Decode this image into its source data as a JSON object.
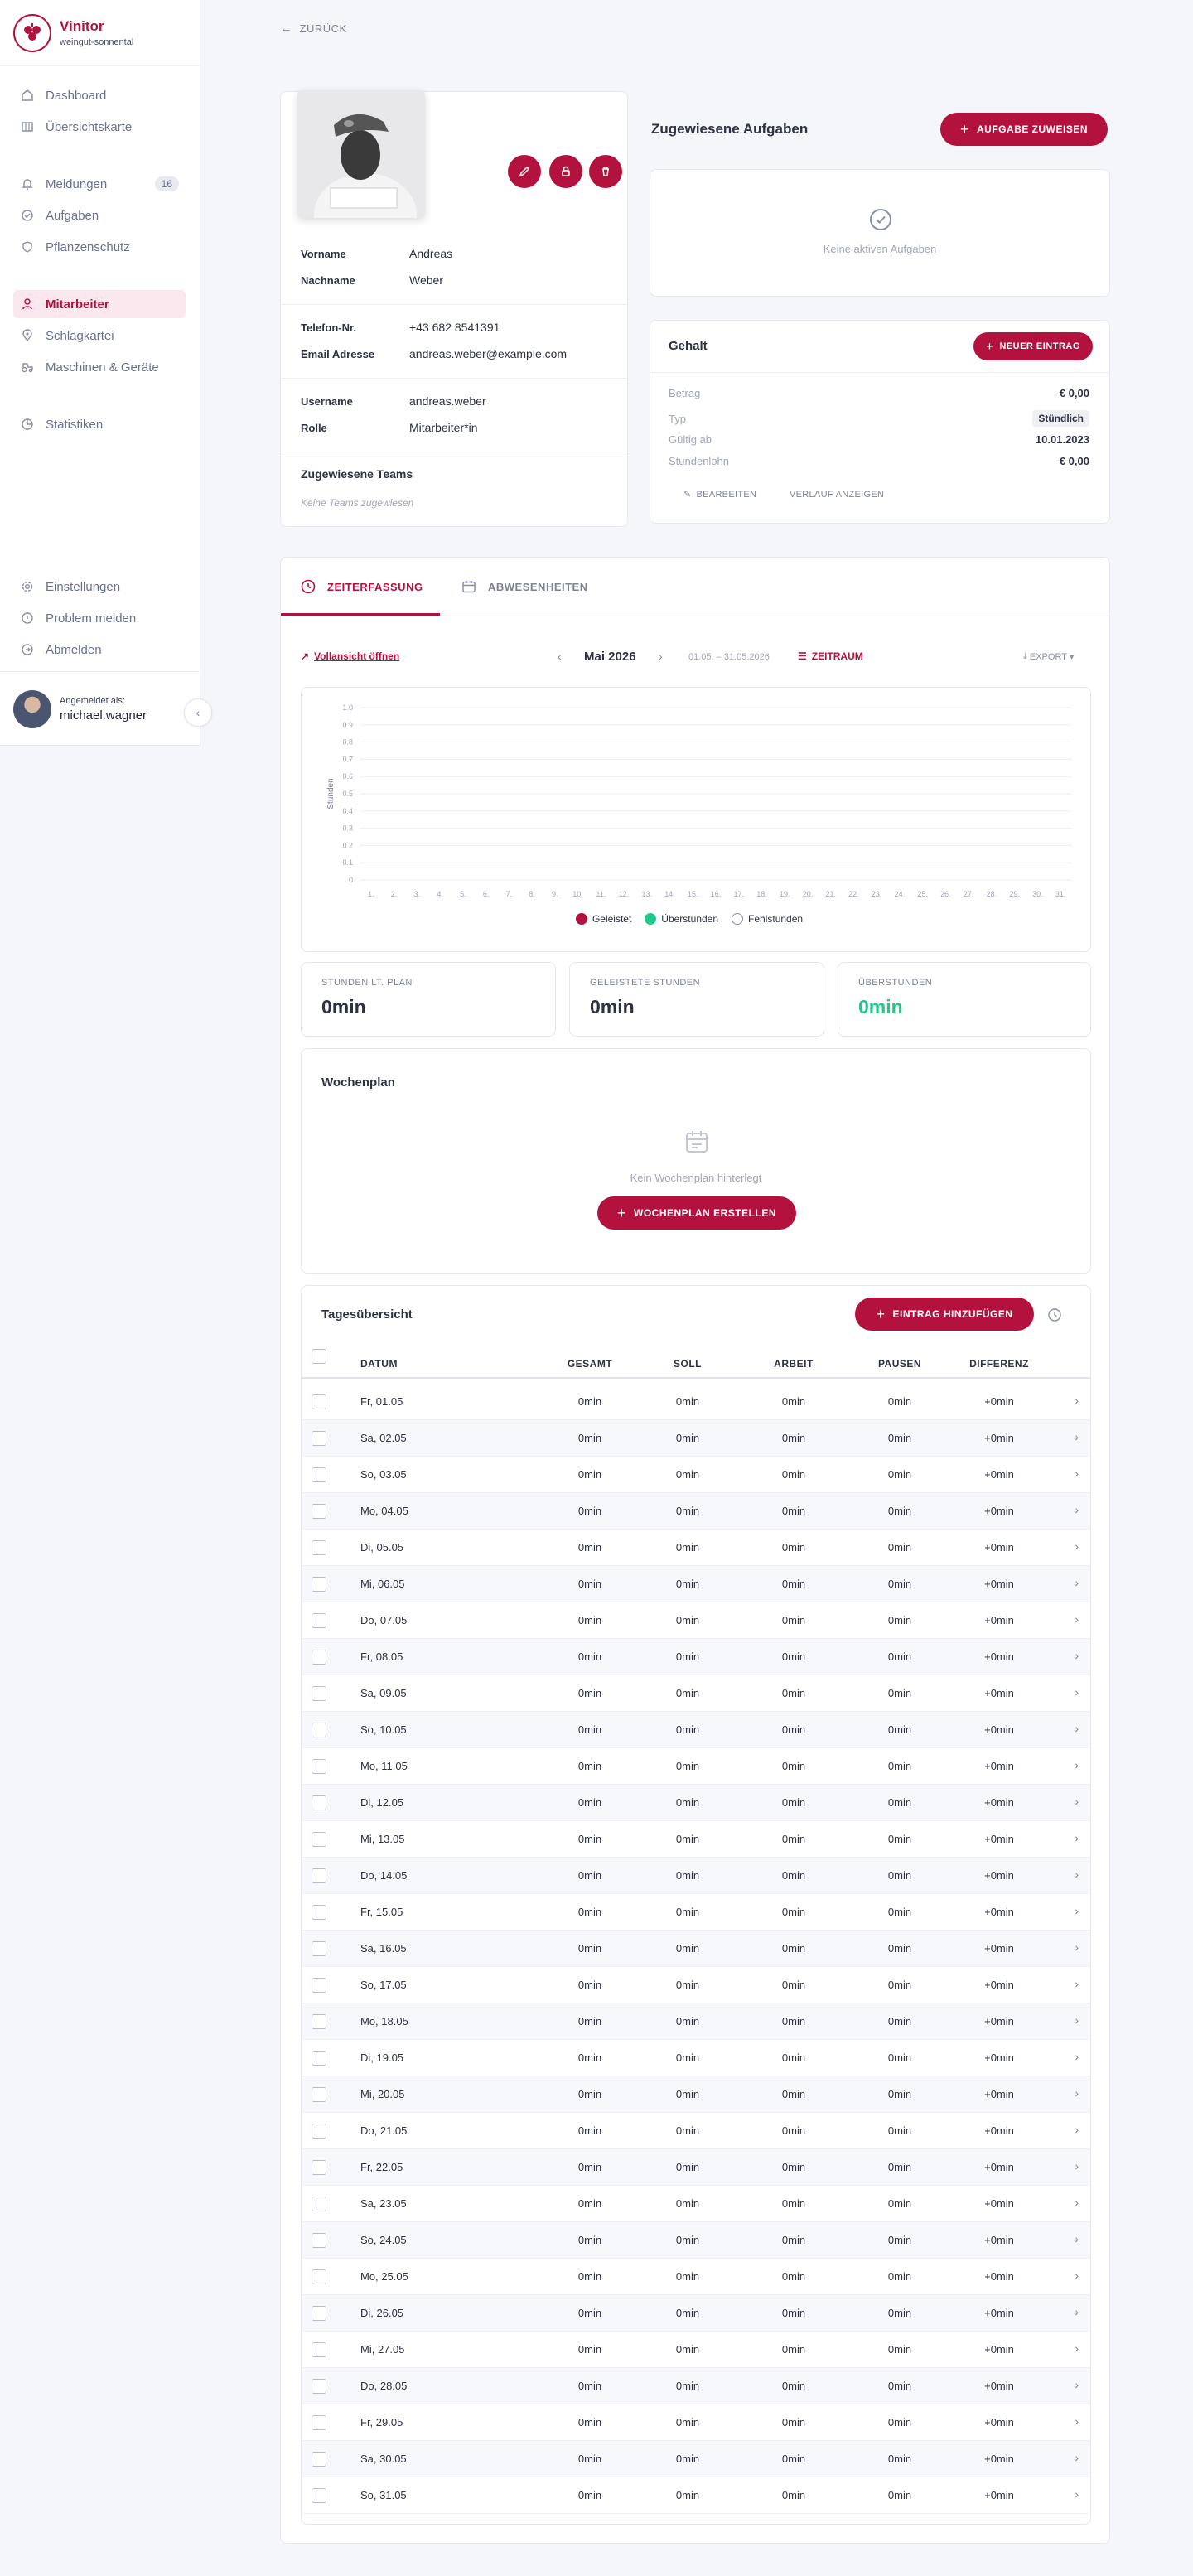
{
  "app": {
    "name": "Vinitor",
    "tenant": "weingut-sonnental"
  },
  "sidebar": {
    "group1": [
      {
        "label": "Dashboard",
        "icon": "home-icon"
      },
      {
        "label": "Übersichtskarte",
        "icon": "map-icon"
      }
    ],
    "group2": [
      {
        "label": "Meldungen",
        "icon": "bell-icon",
        "badge": "16"
      },
      {
        "label": "Aufgaben",
        "icon": "check-circle-icon"
      },
      {
        "label": "Pflanzenschutz",
        "icon": "shield-icon"
      }
    ],
    "group3": [
      {
        "label": "Mitarbeiter",
        "icon": "user-icon"
      },
      {
        "label": "Schlagkartei",
        "icon": "map-pin-icon"
      },
      {
        "label": "Maschinen & Geräte",
        "icon": "tractor-icon"
      }
    ],
    "group4": [
      {
        "label": "Statistiken",
        "icon": "pie-chart-icon"
      }
    ],
    "bottom": [
      {
        "label": "Einstellungen",
        "icon": "gear-icon"
      },
      {
        "label": "Problem melden",
        "icon": "alert-icon"
      },
      {
        "label": "Abmelden",
        "icon": "logout-icon"
      }
    ],
    "user": {
      "prefix": "Angemeldet als:",
      "name": "michael.wagner"
    }
  },
  "back_label": "ZURÜCK",
  "profile": {
    "vorname_label": "Vorname",
    "vorname": "Andreas",
    "nachname_label": "Nachname",
    "nachname": "Weber",
    "tel_label": "Telefon-Nr.",
    "tel": "+43 682 8541391",
    "email_label": "Email Adresse",
    "email": "andreas.weber@example.com",
    "username_label": "Username",
    "username": "andreas.weber",
    "rolle_label": "Rolle",
    "rolle": "Mitarbeiter*in",
    "teams_title": "Zugewiesene Teams",
    "teams_empty": "Keine Teams zugewiesen"
  },
  "tasks": {
    "title": "Zugewiesene Aufgaben",
    "assign_button": "AUFGABE ZUWEISEN",
    "empty": "Keine aktiven Aufgaben"
  },
  "salary": {
    "title": "Gehalt",
    "new_button": "NEUER EINTRAG",
    "rows": [
      {
        "label": "Betrag",
        "value": "€ 0,00"
      },
      {
        "label": "Typ",
        "value": "Stündlich"
      },
      {
        "label": "Gültig ab",
        "value": "10.01.2023"
      },
      {
        "label": "Stundenlohn",
        "value": "€ 0,00"
      }
    ],
    "edit": "BEARBEITEN",
    "history": "VERLAUF ANZEIGEN"
  },
  "tabs": [
    {
      "label": "ZEITERFASSUNG",
      "active": true
    },
    {
      "label": "ABWESENHEITEN",
      "active": false
    }
  ],
  "toolbar": {
    "fullview": "Vollansicht öffnen",
    "month": "Mai 2026",
    "range": "01.05. – 31.05.2026",
    "period": "ZEITRAUM",
    "export": "EXPORT"
  },
  "chart_data": {
    "type": "bar",
    "ylabel": "Stunden",
    "ylim": [
      0,
      1.0
    ],
    "yticks": [
      "1.0",
      "0.9",
      "0.8",
      "0.7",
      "0.6",
      "0.5",
      "0.4",
      "0.3",
      "0.2",
      "0.1",
      "0"
    ],
    "categories": [
      "1.",
      "2.",
      "3.",
      "4.",
      "5.",
      "6.",
      "7.",
      "8.",
      "9.",
      "10.",
      "11.",
      "12.",
      "13.",
      "14.",
      "15.",
      "16.",
      "17.",
      "18.",
      "19.",
      "20.",
      "21.",
      "22.",
      "23.",
      "24.",
      "25.",
      "26.",
      "27.",
      "28.",
      "29.",
      "30.",
      "31."
    ],
    "series": [
      {
        "name": "Geleistet",
        "color": "#b3123f",
        "values": [
          0,
          0,
          0,
          0,
          0,
          0,
          0,
          0,
          0,
          0,
          0,
          0,
          0,
          0,
          0,
          0,
          0,
          0,
          0,
          0,
          0,
          0,
          0,
          0,
          0,
          0,
          0,
          0,
          0,
          0,
          0
        ]
      },
      {
        "name": "Überstunden",
        "color": "#1ec98a",
        "values": [
          0,
          0,
          0,
          0,
          0,
          0,
          0,
          0,
          0,
          0,
          0,
          0,
          0,
          0,
          0,
          0,
          0,
          0,
          0,
          0,
          0,
          0,
          0,
          0,
          0,
          0,
          0,
          0,
          0,
          0,
          0
        ]
      },
      {
        "name": "Fehlstunden",
        "color": "#ffffff",
        "values": [
          0,
          0,
          0,
          0,
          0,
          0,
          0,
          0,
          0,
          0,
          0,
          0,
          0,
          0,
          0,
          0,
          0,
          0,
          0,
          0,
          0,
          0,
          0,
          0,
          0,
          0,
          0,
          0,
          0,
          0,
          0
        ]
      }
    ],
    "grid": true,
    "legend": "bottom"
  },
  "stats": [
    {
      "label": "STUNDEN LT. PLAN",
      "value": "0min",
      "color": "#2d3142"
    },
    {
      "label": "GELEISTETE STUNDEN",
      "value": "0min",
      "color": "#2d3142"
    },
    {
      "label": "ÜBERSTUNDEN",
      "value": "0min",
      "color": "#1ec98a"
    }
  ],
  "weekplan": {
    "title": "Wochenplan",
    "empty": "Kein Wochenplan hinterlegt",
    "create": "WOCHENPLAN ERSTELLEN"
  },
  "daily": {
    "title": "Tagesübersicht",
    "add": "EINTRAG HINZUFÜGEN",
    "headers": [
      "DATUM",
      "GESAMT",
      "SOLL",
      "ARBEIT",
      "PAUSEN",
      "DIFFERENZ"
    ],
    "rows": [
      [
        "Fr, 01.05",
        "0min",
        "0min",
        "0min",
        "0min",
        "+0min"
      ],
      [
        "Sa, 02.05",
        "0min",
        "0min",
        "0min",
        "0min",
        "+0min"
      ],
      [
        "So, 03.05",
        "0min",
        "0min",
        "0min",
        "0min",
        "+0min"
      ],
      [
        "Mo, 04.05",
        "0min",
        "0min",
        "0min",
        "0min",
        "+0min"
      ],
      [
        "Di, 05.05",
        "0min",
        "0min",
        "0min",
        "0min",
        "+0min"
      ],
      [
        "Mi, 06.05",
        "0min",
        "0min",
        "0min",
        "0min",
        "+0min"
      ],
      [
        "Do, 07.05",
        "0min",
        "0min",
        "0min",
        "0min",
        "+0min"
      ],
      [
        "Fr, 08.05",
        "0min",
        "0min",
        "0min",
        "0min",
        "+0min"
      ],
      [
        "Sa, 09.05",
        "0min",
        "0min",
        "0min",
        "0min",
        "+0min"
      ],
      [
        "So, 10.05",
        "0min",
        "0min",
        "0min",
        "0min",
        "+0min"
      ],
      [
        "Mo, 11.05",
        "0min",
        "0min",
        "0min",
        "0min",
        "+0min"
      ],
      [
        "Di, 12.05",
        "0min",
        "0min",
        "0min",
        "0min",
        "+0min"
      ],
      [
        "Mi, 13.05",
        "0min",
        "0min",
        "0min",
        "0min",
        "+0min"
      ],
      [
        "Do, 14.05",
        "0min",
        "0min",
        "0min",
        "0min",
        "+0min"
      ],
      [
        "Fr, 15.05",
        "0min",
        "0min",
        "0min",
        "0min",
        "+0min"
      ],
      [
        "Sa, 16.05",
        "0min",
        "0min",
        "0min",
        "0min",
        "+0min"
      ],
      [
        "So, 17.05",
        "0min",
        "0min",
        "0min",
        "0min",
        "+0min"
      ],
      [
        "Mo, 18.05",
        "0min",
        "0min",
        "0min",
        "0min",
        "+0min"
      ],
      [
        "Di, 19.05",
        "0min",
        "0min",
        "0min",
        "0min",
        "+0min"
      ],
      [
        "Mi, 20.05",
        "0min",
        "0min",
        "0min",
        "0min",
        "+0min"
      ],
      [
        "Do, 21.05",
        "0min",
        "0min",
        "0min",
        "0min",
        "+0min"
      ],
      [
        "Fr, 22.05",
        "0min",
        "0min",
        "0min",
        "0min",
        "+0min"
      ],
      [
        "Sa, 23.05",
        "0min",
        "0min",
        "0min",
        "0min",
        "+0min"
      ],
      [
        "So, 24.05",
        "0min",
        "0min",
        "0min",
        "0min",
        "+0min"
      ],
      [
        "Mo, 25.05",
        "0min",
        "0min",
        "0min",
        "0min",
        "+0min"
      ],
      [
        "Di, 26.05",
        "0min",
        "0min",
        "0min",
        "0min",
        "+0min"
      ],
      [
        "Mi, 27.05",
        "0min",
        "0min",
        "0min",
        "0min",
        "+0min"
      ],
      [
        "Do, 28.05",
        "0min",
        "0min",
        "0min",
        "0min",
        "+0min"
      ],
      [
        "Fr, 29.05",
        "0min",
        "0min",
        "0min",
        "0min",
        "+0min"
      ],
      [
        "Sa, 30.05",
        "0min",
        "0min",
        "0min",
        "0min",
        "+0min"
      ],
      [
        "So, 31.05",
        "0min",
        "0min",
        "0min",
        "0min",
        "+0min"
      ]
    ]
  },
  "colors": {
    "accent": "#b3123f",
    "accent_light": "#fbe7ee",
    "green": "#1ec98a"
  }
}
